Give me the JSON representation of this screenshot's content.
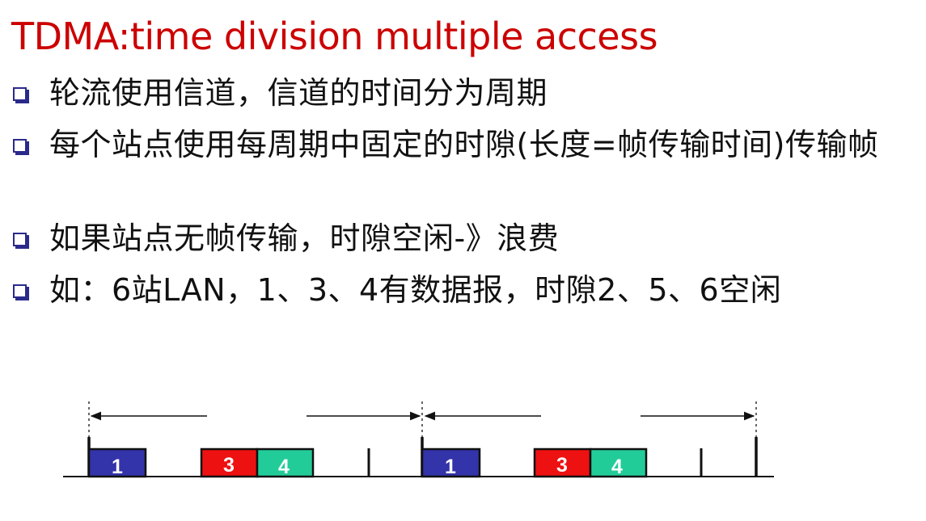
{
  "title": "TDMA:time division multiple access",
  "bullets": [
    "轮流使用信道，信道的时间分为周期",
    "每个站点使用每周期中固定的时隙(长度=帧传输时间)传输帧",
    "如果站点无帧传输，时隙空闲-》浪费",
    "如：6站LAN，1、3、4有数据报，时隙2、5、6空闲"
  ],
  "diagram": {
    "frames": [
      {
        "label": "1",
        "color": "#3333aa"
      },
      {
        "label": "3",
        "color": "#ee1111"
      },
      {
        "label": "4",
        "color": "#22cc99"
      },
      {
        "label": "1",
        "color": "#3333aa"
      },
      {
        "label": "3",
        "color": "#ee1111"
      },
      {
        "label": "4",
        "color": "#22cc99"
      }
    ]
  },
  "colors": {
    "title": "#cc0000",
    "bullet_marker": "#2a2a8c",
    "text": "#111111"
  }
}
